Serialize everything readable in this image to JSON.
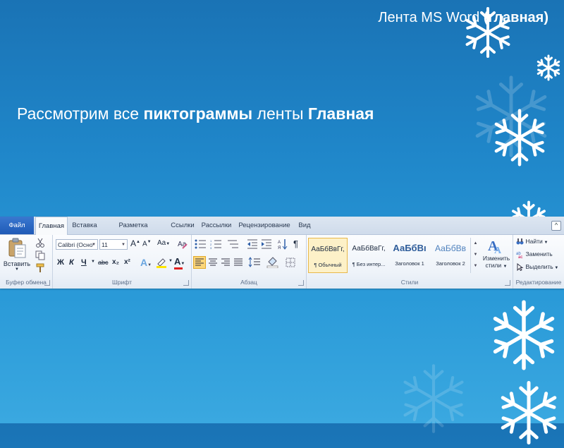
{
  "slide": {
    "title_normal": "Лента MS Word ",
    "title_bold": "(главная)",
    "text_normal_1": "Рассмотрим все ",
    "text_bold_1": "пиктограммы",
    "text_normal_2": " ленты ",
    "text_bold_2": "Главная"
  },
  "ribbon": {
    "tabs": [
      "Файл",
      "Главная",
      "Вставка",
      "Разметка страницы",
      "Ссылки",
      "Рассылки",
      "Рецензирование",
      "Вид"
    ],
    "active_tab": "Главная",
    "clipboard": {
      "paste_label": "Вставить",
      "group_label": "Буфер обмена"
    },
    "font": {
      "font_name": "Calibri (Осно",
      "font_size": "11",
      "grow": "A",
      "shrink": "A",
      "case": "Aa",
      "bold": "Ж",
      "italic": "К",
      "underline": "Ч",
      "strike": "abc",
      "subscript": "x₂",
      "superscript": "x²",
      "text_effects": "A",
      "font_color": "A",
      "group_label": "Шрифт"
    },
    "paragraph": {
      "pilcrow": "¶",
      "group_label": "Абзац"
    },
    "styles": {
      "items": [
        {
          "preview": "АаБбВвГг,",
          "name": "¶ Обычный"
        },
        {
          "preview": "АаБбВвГг,",
          "name": "¶ Без интер..."
        },
        {
          "preview": "АаБбВı",
          "name": "Заголовок 1"
        },
        {
          "preview": "АаБбВв",
          "name": "Заголовок 2"
        }
      ],
      "change_styles_line1": "Изменить",
      "change_styles_line2": "стили",
      "group_label": "Стили"
    },
    "editing": {
      "find": "Найти",
      "replace": "Заменить",
      "select": "Выделить",
      "group_label": "Редактирование"
    }
  },
  "colors": {
    "background_top": "#1a73b5",
    "background_bottom": "#3aa8e0",
    "file_tab": "#1f5ab7",
    "highlight": "#fdf1c8",
    "font_color_bar": "#e02020",
    "highlighter_bar": "#ffe600"
  }
}
